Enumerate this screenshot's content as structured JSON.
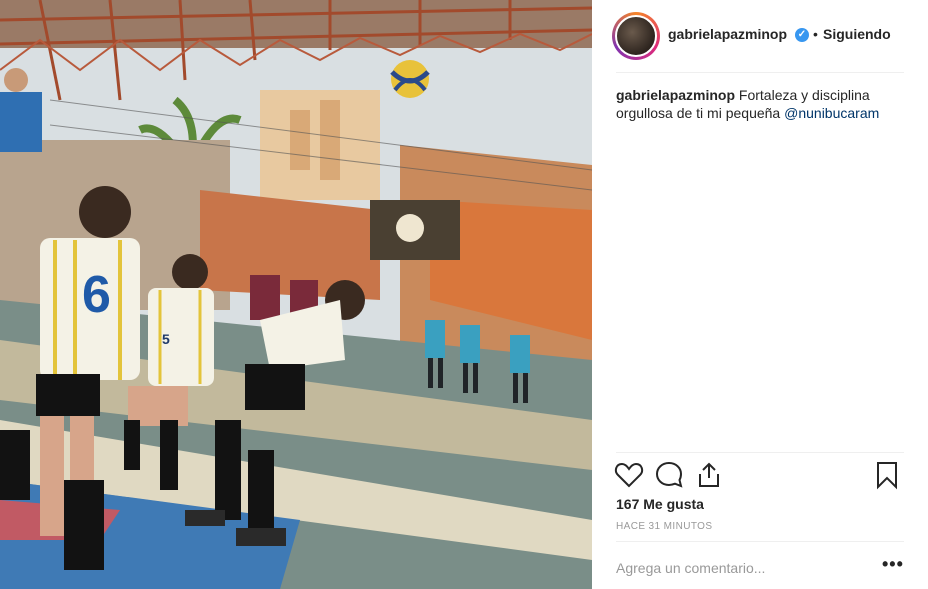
{
  "post": {
    "username": "gabrielapazminop",
    "follow_status": "Siguiendo",
    "separator": "•",
    "caption_user": "gabrielapazminop",
    "caption_text": "Fortaleza y disciplina orgullosa de ti mi pequeña",
    "caption_mention": "@nunibucaram",
    "likes": "167 Me gusta",
    "timestamp": "HACE 31 MINUTOS",
    "comment_placeholder": "Agrega un comentario...",
    "more_label": "•••",
    "verified_mark": "✓"
  },
  "photo": {
    "jersey_numbers": [
      "6",
      "5"
    ]
  },
  "icons": {
    "like": "heart-icon",
    "comment": "comment-icon",
    "share": "share-icon",
    "save": "bookmark-icon"
  },
  "colors": {
    "verified": "#3897f0",
    "mention": "#003569",
    "muted": "#999999"
  }
}
